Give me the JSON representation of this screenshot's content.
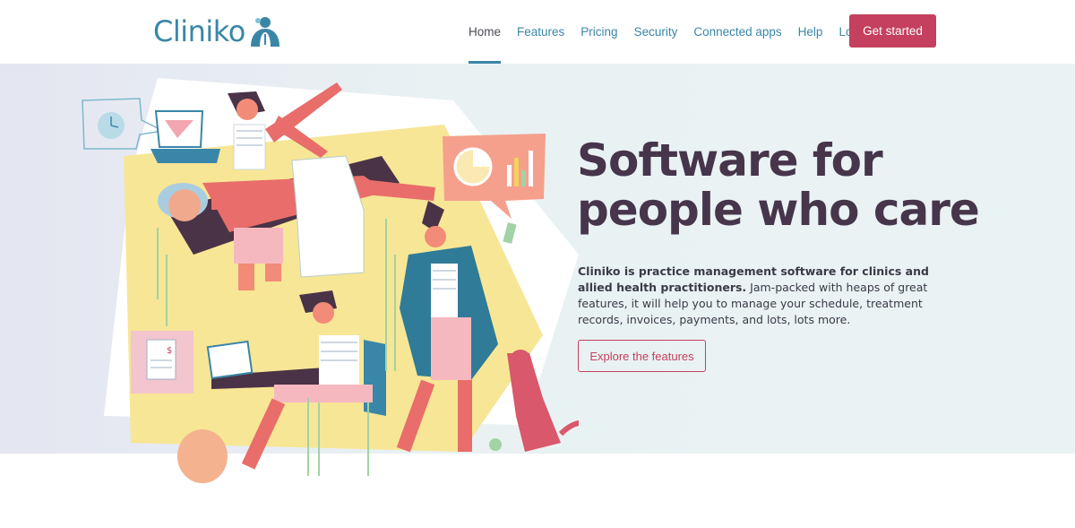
{
  "brand": {
    "name": "Cliniko",
    "primary_color": "#3a86a9",
    "accent_color": "#c4405e",
    "headline_color": "#46354b"
  },
  "nav": {
    "items": [
      {
        "label": "Home",
        "active": true
      },
      {
        "label": "Features",
        "active": false
      },
      {
        "label": "Pricing",
        "active": false
      },
      {
        "label": "Security",
        "active": false
      },
      {
        "label": "Connected apps",
        "active": false
      },
      {
        "label": "Help",
        "active": false
      },
      {
        "label": "Log in",
        "active": false
      }
    ],
    "cta_label": "Get started"
  },
  "hero": {
    "headline_line1": "Software for",
    "headline_line2": "people who care",
    "description_bold": "Cliniko is practice management software for clinics and allied health practitioners.",
    "description_rest": " Jam-packed with heaps of great features, it will help you to manage your schedule, treatment records, invoices, payments, and lots, lots more.",
    "cta_label": "Explore the features",
    "invoice_symbol": "$"
  },
  "icons": {
    "logo": "cliniko-logo-icon",
    "clock": "clock-icon",
    "chart": "pie-bar-chart-icon",
    "invoice": "invoice-icon"
  }
}
